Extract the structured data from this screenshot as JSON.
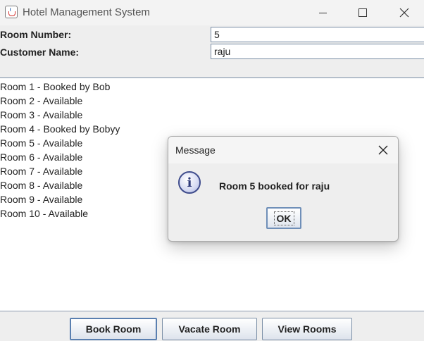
{
  "window": {
    "title": "Hotel Management System",
    "icon": "java-cup-icon"
  },
  "form": {
    "room_number_label": "Room Number:",
    "room_number_value": "5",
    "customer_name_label": "Customer Name:",
    "customer_name_value": "raju"
  },
  "rooms": [
    "Room 1 - Booked by Bob",
    "Room 2 - Available",
    "Room 3 - Available",
    "Room 4 - Booked by Bobyy",
    "Room 5 - Available",
    "Room 6 - Available",
    "Room 7 - Available",
    "Room 8 - Available",
    "Room 9 - Available",
    "Room 10 - Available"
  ],
  "buttons": {
    "book": "Book Room",
    "vacate": "Vacate Room",
    "view": "View Rooms"
  },
  "dialog": {
    "title": "Message",
    "message": "Room 5 booked for raju",
    "ok_label": "OK",
    "icon": "information-icon"
  },
  "colors": {
    "field_border": "#7a8ea5",
    "focus_border": "#5a7fb0",
    "panel_background": "#eeeeee"
  }
}
